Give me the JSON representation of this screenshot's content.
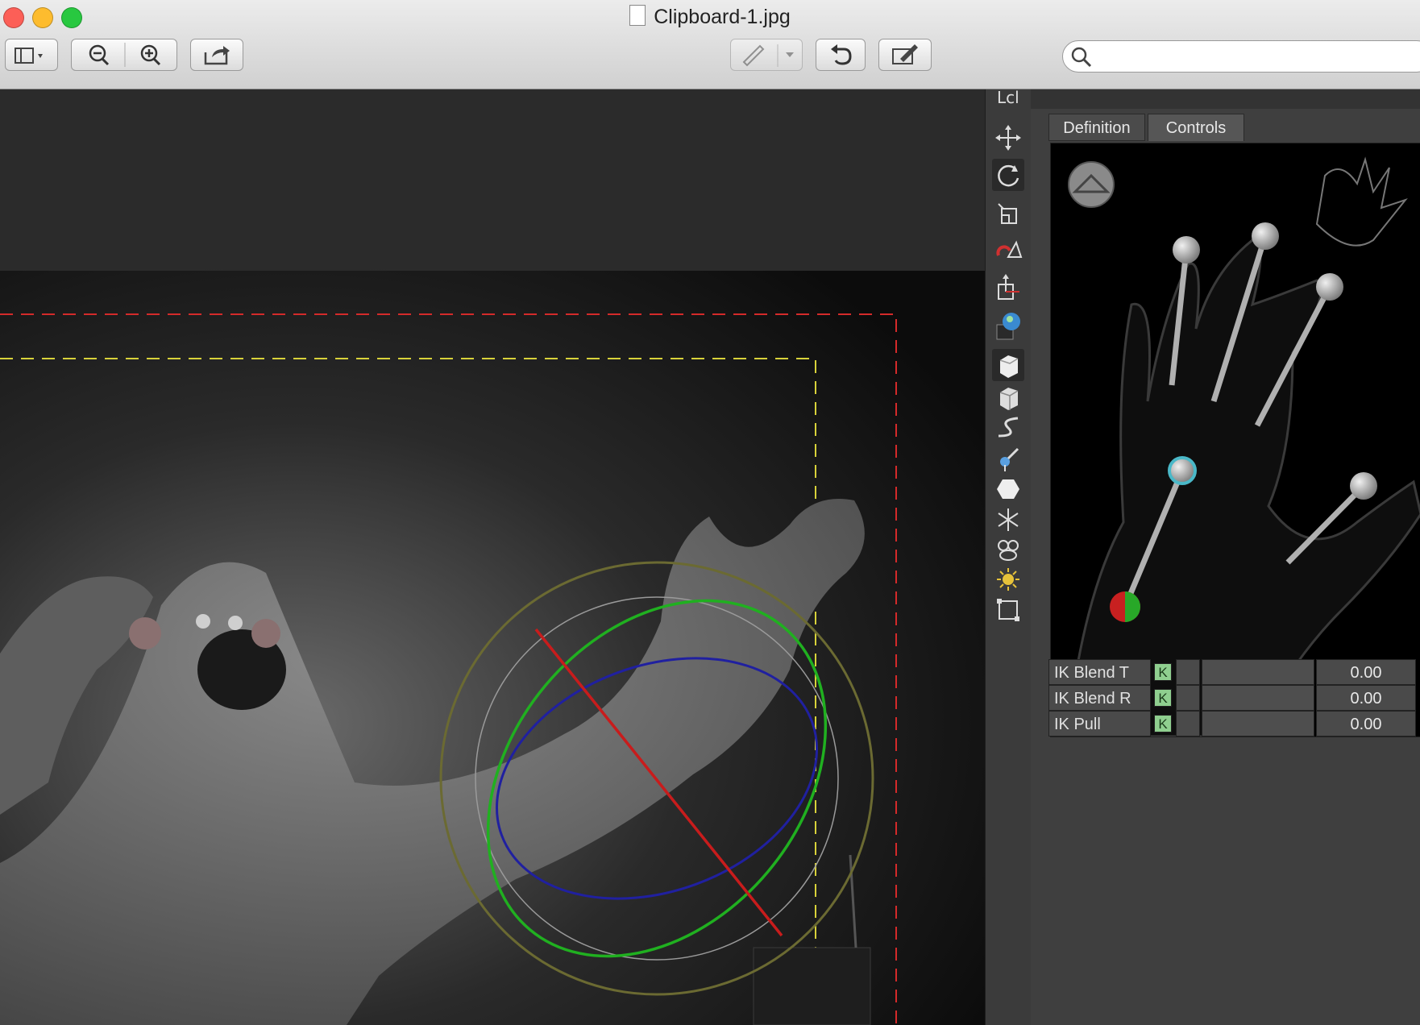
{
  "window": {
    "title": "Clipboard-1.jpg"
  },
  "toolbar": {
    "buttons": [
      "sidebar-toggle",
      "zoom-out",
      "zoom-in",
      "share",
      "markup",
      "rotate",
      "annotate"
    ],
    "search_placeholder": ""
  },
  "tools": {
    "mode_label": "Lcl",
    "icons": [
      "move-icon",
      "rotate-icon",
      "scale-icon",
      "magnet-snap-icon",
      "pivot-icon",
      "sphere-select-icon",
      "cube-solid-icon",
      "cube-icon",
      "curve-icon",
      "bone-icon",
      "hexagon-icon",
      "star-null-icon",
      "character-icon",
      "light-icon",
      "frame-icon"
    ]
  },
  "panel": {
    "tabs": [
      {
        "label": "Definition",
        "active": false
      },
      {
        "label": "Controls",
        "active": true
      }
    ],
    "properties": [
      {
        "label": "IK Blend T",
        "key": "K",
        "value": "0.00"
      },
      {
        "label": "IK Blend R",
        "key": "K",
        "value": "0.00"
      },
      {
        "label": "IK Pull",
        "key": "K",
        "value": "0.00"
      }
    ]
  },
  "colors": {
    "safe_frame_outer": "#d42a2a",
    "safe_frame_inner": "#d8d23a",
    "gizmo_x": "#c81c1c",
    "gizmo_y": "#20b020",
    "gizmo_z": "#2020a0",
    "k_button": "#8fcf8f"
  }
}
